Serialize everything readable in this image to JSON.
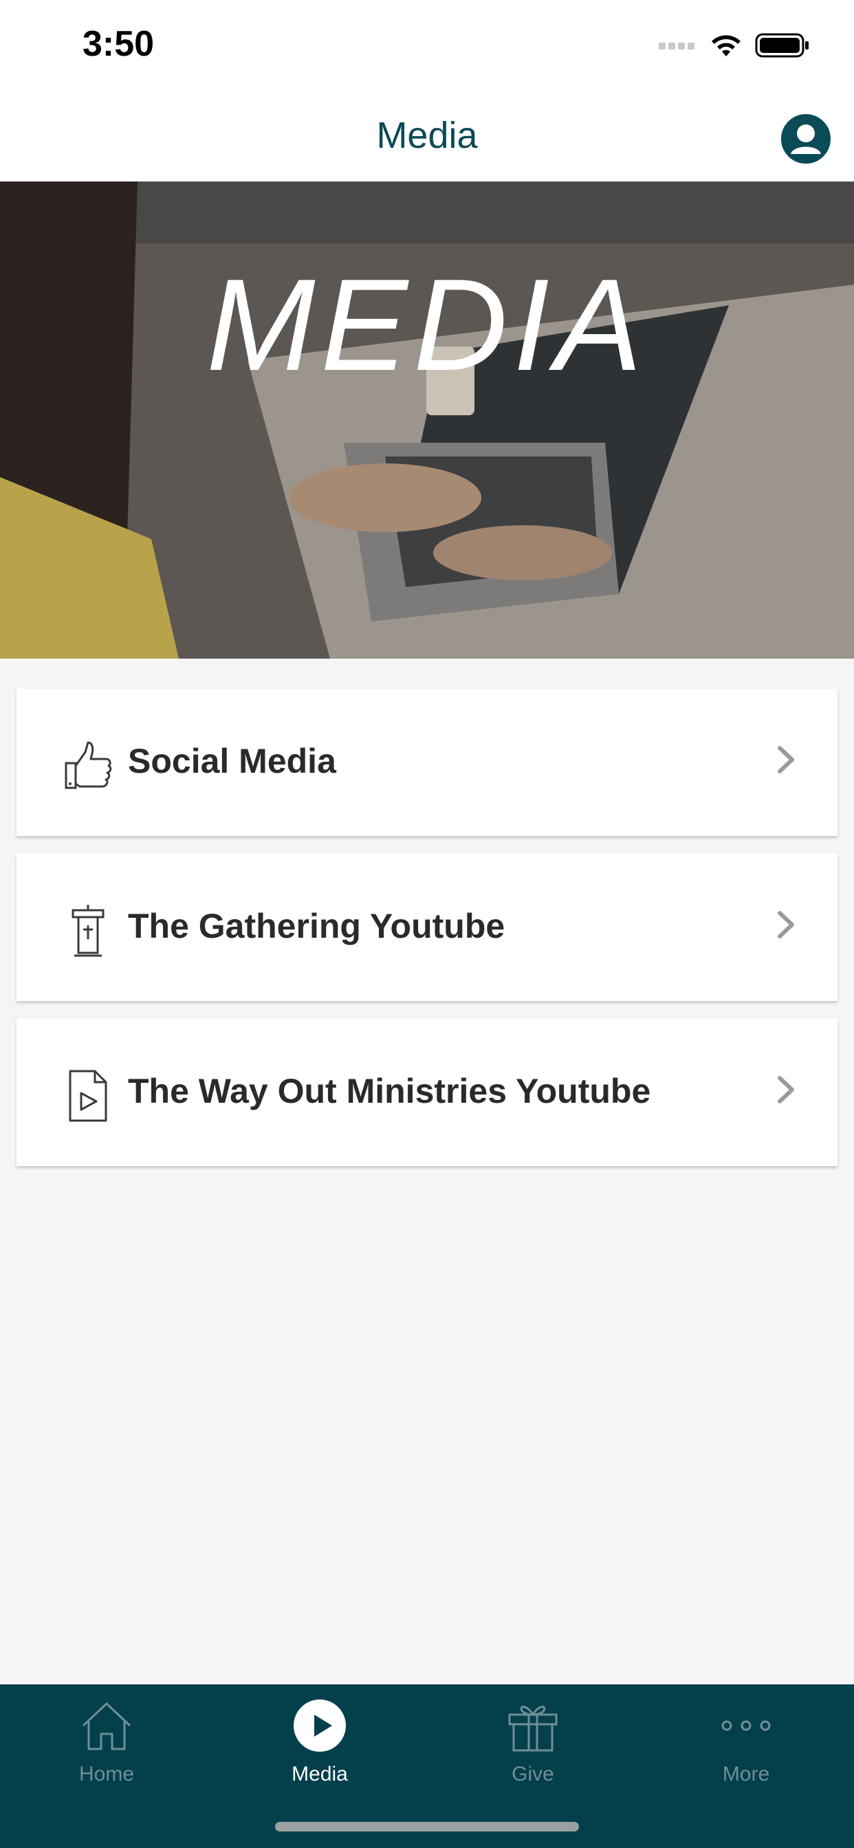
{
  "status_bar": {
    "time": "3:50"
  },
  "header": {
    "title": "Media"
  },
  "hero": {
    "title": "MEDIA"
  },
  "menu": {
    "items": [
      {
        "label": "Social Media",
        "icon": "thumbs-up-icon"
      },
      {
        "label": "The Gathering Youtube",
        "icon": "pulpit-icon"
      },
      {
        "label": "The Way Out Ministries Youtube",
        "icon": "video-file-icon"
      }
    ]
  },
  "tabs": [
    {
      "label": "Home",
      "icon": "home-icon",
      "active": false
    },
    {
      "label": "Media",
      "icon": "play-icon",
      "active": true
    },
    {
      "label": "Give",
      "icon": "gift-icon",
      "active": false
    },
    {
      "label": "More",
      "icon": "more-dots-icon",
      "active": false
    }
  ],
  "colors": {
    "primary": "#043f4c",
    "title": "#0d4a57",
    "tab_inactive": "#6f8f96",
    "background": "#f5f5f5"
  }
}
